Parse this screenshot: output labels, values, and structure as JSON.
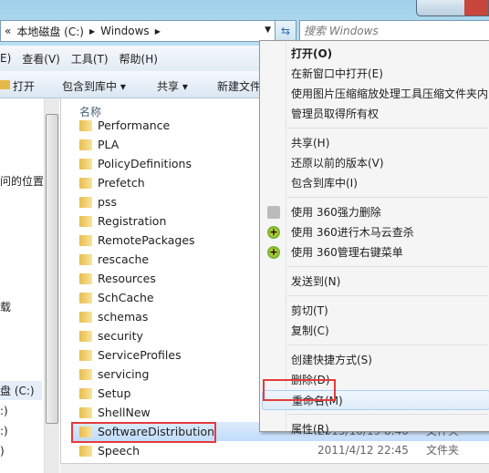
{
  "address": {
    "overflow": "«",
    "crumbs": [
      "本地磁盘 (C:)",
      "Windows"
    ]
  },
  "search": {
    "placeholder": "搜索 Windows"
  },
  "menubar": [
    "E)",
    "查看(V)",
    "工具(T)",
    "帮助(H)"
  ],
  "toolbar": {
    "open": "打开",
    "include": "包含到库中 ▾",
    "share": "共享 ▾",
    "new_folder": "新建文件"
  },
  "nav": [
    "问的位置",
    "载",
    "盘 (C:)",
    ":)",
    ":)",
    ")"
  ],
  "list": {
    "header": "名称",
    "rows": [
      {
        "name": "Performance"
      },
      {
        "name": "PLA"
      },
      {
        "name": "PolicyDefinitions"
      },
      {
        "name": "Prefetch",
        "locked": true
      },
      {
        "name": "pss"
      },
      {
        "name": "Registration"
      },
      {
        "name": "RemotePackages"
      },
      {
        "name": "rescache"
      },
      {
        "name": "Resources"
      },
      {
        "name": "SchCache"
      },
      {
        "name": "schemas"
      },
      {
        "name": "security"
      },
      {
        "name": "ServiceProfiles"
      },
      {
        "name": "servicing"
      },
      {
        "name": "Setup"
      },
      {
        "name": "ShellNew"
      },
      {
        "name": "SoftwareDistribution",
        "date": "2015/10/19 8:40",
        "type": "文件夹",
        "selected": true
      },
      {
        "name": "Speech",
        "date": "2011/4/12 22:45",
        "type": "文件夹"
      }
    ]
  },
  "context_menu": [
    {
      "label": "打开(O)",
      "bold": true
    },
    {
      "label": "在新窗口中打开(E)"
    },
    {
      "label": "使用图片压缩缩放处理工具压缩文件夹内的图片"
    },
    {
      "label": "管理员取得所有权"
    },
    {
      "sep": true
    },
    {
      "label": "共享(H)"
    },
    {
      "label": "还原以前的版本(V)"
    },
    {
      "label": "包含到库中(I)"
    },
    {
      "sep": true
    },
    {
      "label": "使用 360强力删除",
      "icon": "shredder-icon"
    },
    {
      "label": "使用 360进行木马云查杀",
      "icon": "360-icon"
    },
    {
      "label": "使用 360管理右键菜单",
      "icon": "360-icon"
    },
    {
      "sep": true
    },
    {
      "label": "发送到(N)"
    },
    {
      "sep": true
    },
    {
      "label": "剪切(T)"
    },
    {
      "label": "复制(C)"
    },
    {
      "sep": true
    },
    {
      "label": "创建快捷方式(S)"
    },
    {
      "label": "删除(D)"
    },
    {
      "label": "重命名(M)",
      "highlighted": true
    },
    {
      "sep": true
    },
    {
      "label": "属性(R)"
    }
  ],
  "colors": {
    "highlight_box": "#e53b3b",
    "selection": "#c1dcfc"
  }
}
